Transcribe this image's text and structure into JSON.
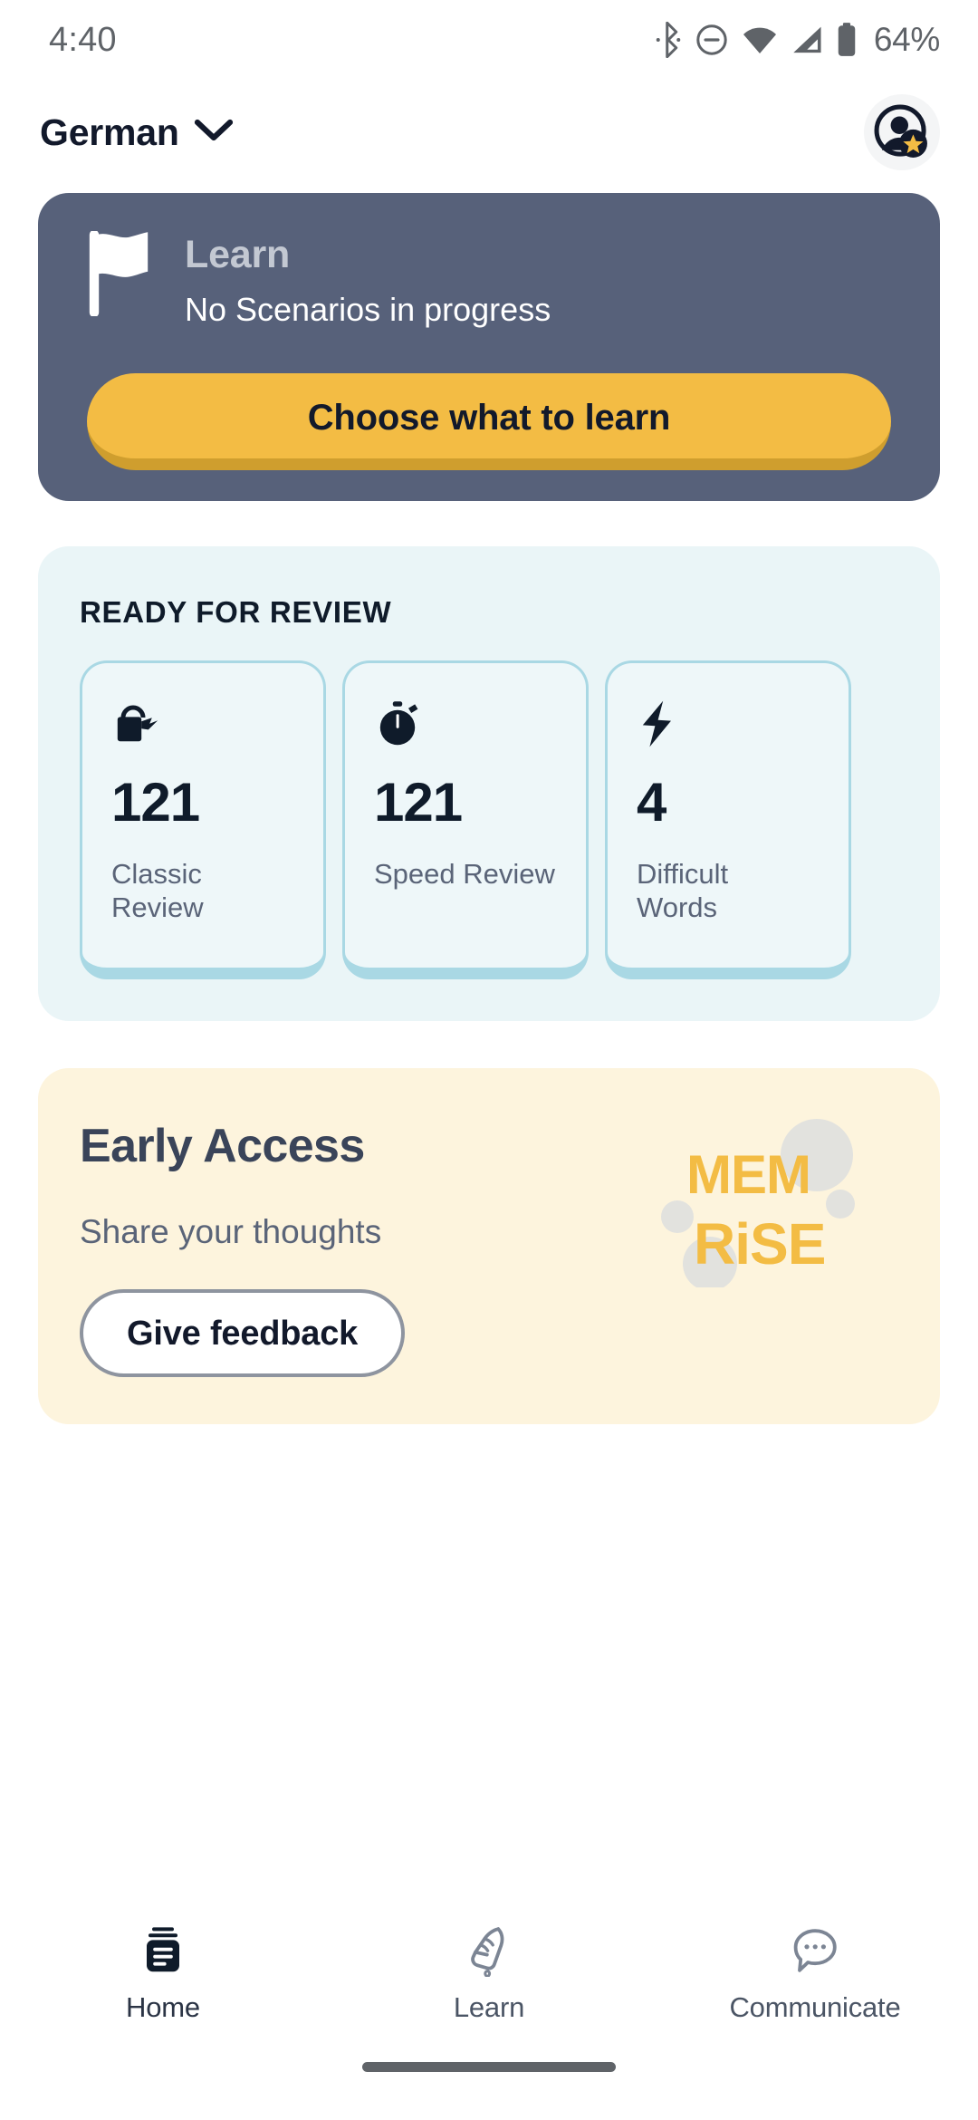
{
  "status_bar": {
    "time": "4:40",
    "battery_percent": "64%",
    "icons": [
      "bluetooth-icon",
      "do-not-disturb-icon",
      "wifi-icon",
      "cellular-signal-icon",
      "battery-icon"
    ]
  },
  "header": {
    "language": "German",
    "chevron": "chevron-down-icon",
    "avatar": "profile-avatar-with-star-badge"
  },
  "learn_card": {
    "icon": "flag-icon",
    "title": "Learn",
    "subtitle": "No Scenarios in progress",
    "cta_label": "Choose what to learn",
    "background_color": "#57617a",
    "cta_color": "#f3bc44",
    "cta_shadow_color": "#cf9e2e"
  },
  "review_card": {
    "heading": "READY FOR REVIEW",
    "background_color": "#eaf5f7",
    "tiles": [
      {
        "icon": "watering-can-icon",
        "value": "121",
        "label": "Classic Review"
      },
      {
        "icon": "stopwatch-icon",
        "value": "121",
        "label": "Speed Review"
      },
      {
        "icon": "lightning-bolt-icon",
        "value": "4",
        "label": "Difficult Words"
      }
    ]
  },
  "early_access_card": {
    "title": "Early Access",
    "subtitle": "Share your thoughts",
    "button_label": "Give feedback",
    "brand_top": "MEM",
    "brand_bottom": "RiSE",
    "background_color": "#fdf4dd",
    "brand_color": "#f3bc44"
  },
  "bottom_nav": {
    "items": [
      {
        "label": "Home",
        "icon": "flashcards-icon",
        "active": true
      },
      {
        "label": "Learn",
        "icon": "pointing-hand-icon",
        "active": false
      },
      {
        "label": "Communicate",
        "icon": "speech-bubble-icon",
        "active": false
      }
    ]
  }
}
